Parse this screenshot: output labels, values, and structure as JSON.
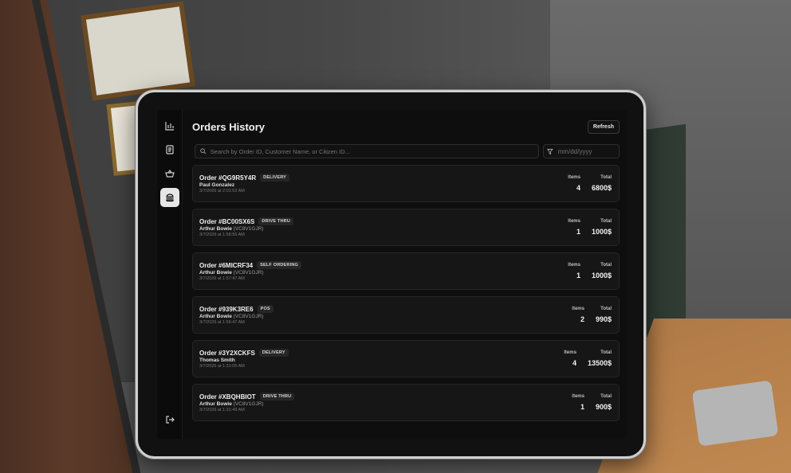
{
  "page": {
    "title": "Orders History",
    "refresh_label": "Refresh",
    "search_placeholder": "Search by Order ID, Customer Name, or Citizen ID...",
    "date_placeholder": "mm/dd/yyyy"
  },
  "sidebar": {
    "items": [
      {
        "icon": "bar-chart-icon",
        "active": false
      },
      {
        "icon": "receipt-icon",
        "active": false
      },
      {
        "icon": "basket-icon",
        "active": false
      },
      {
        "icon": "burger-icon",
        "active": true
      }
    ],
    "logout_icon": "logout-icon"
  },
  "labels": {
    "items": "Items",
    "total": "Total"
  },
  "orders": [
    {
      "id": "Order #QG9R5Y4R",
      "type": "DELIVERY",
      "customer": "Paul Gonzalez",
      "citizen_id": "",
      "date": "3/7/2026 at 2:01:53 AM",
      "items": "4",
      "total": "6800$"
    },
    {
      "id": "Order #BC00SX6S",
      "type": "DRIVE THRU",
      "customer": "Arthur Bowie",
      "citizen_id": "(VC8V1GJR)",
      "date": "3/7/2026 at 1:58:56 AM",
      "items": "1",
      "total": "1000$"
    },
    {
      "id": "Order #6MICRF34",
      "type": "SELF ORDERING",
      "customer": "Arthur Bowie",
      "citizen_id": "(VC8V1GJR)",
      "date": "3/7/2026 at 1:57:47 AM",
      "items": "1",
      "total": "1000$"
    },
    {
      "id": "Order #939K3RE6",
      "type": "POS",
      "customer": "Arthur Bowie",
      "citizen_id": "(VC8V1GJR)",
      "date": "3/7/2026 at 1:56:47 AM",
      "items": "2",
      "total": "990$"
    },
    {
      "id": "Order #3Y2XCKFS",
      "type": "DELIVERY",
      "customer": "Thomas Smith",
      "citizen_id": "",
      "date": "3/7/2026 at 1:31:05 AM",
      "items": "4",
      "total": "13500$"
    },
    {
      "id": "Order #XBQHBIOT",
      "type": "DRIVE THRU",
      "customer": "Arthur Bowie",
      "citizen_id": "(VC8V1GJR)",
      "date": "3/7/2026 at 1:31:49 AM",
      "items": "1",
      "total": "900$"
    }
  ]
}
